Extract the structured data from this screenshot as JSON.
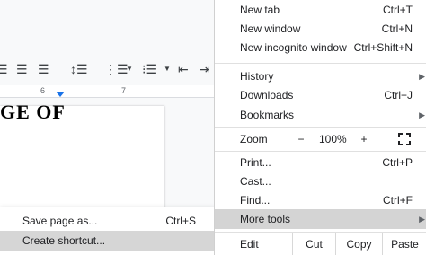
{
  "editor": {
    "ruler_numbers": [
      "6",
      "7"
    ],
    "doc_text": "GE OF"
  },
  "submenu": {
    "items": [
      {
        "label": "Save page as...",
        "shortcut": "Ctrl+S"
      },
      {
        "label": "Create shortcut...",
        "shortcut": ""
      }
    ]
  },
  "menu": {
    "new_tab": {
      "label": "New tab",
      "shortcut": "Ctrl+T"
    },
    "new_window": {
      "label": "New window",
      "shortcut": "Ctrl+N"
    },
    "new_incognito": {
      "label": "New incognito window",
      "shortcut": "Ctrl+Shift+N"
    },
    "history": {
      "label": "History"
    },
    "downloads": {
      "label": "Downloads",
      "shortcut": "Ctrl+J"
    },
    "bookmarks": {
      "label": "Bookmarks"
    },
    "zoom": {
      "label": "Zoom",
      "minus": "−",
      "value": "100%",
      "plus": "+"
    },
    "print": {
      "label": "Print...",
      "shortcut": "Ctrl+P"
    },
    "cast": {
      "label": "Cast..."
    },
    "find": {
      "label": "Find...",
      "shortcut": "Ctrl+F"
    },
    "more_tools": {
      "label": "More tools"
    },
    "edit": {
      "label": "Edit",
      "cut": "Cut",
      "copy": "Copy",
      "paste": "Paste"
    }
  },
  "icons": {
    "submenu_arrow": "chevron-right-icon",
    "fullscreen": "fullscreen-icon"
  }
}
